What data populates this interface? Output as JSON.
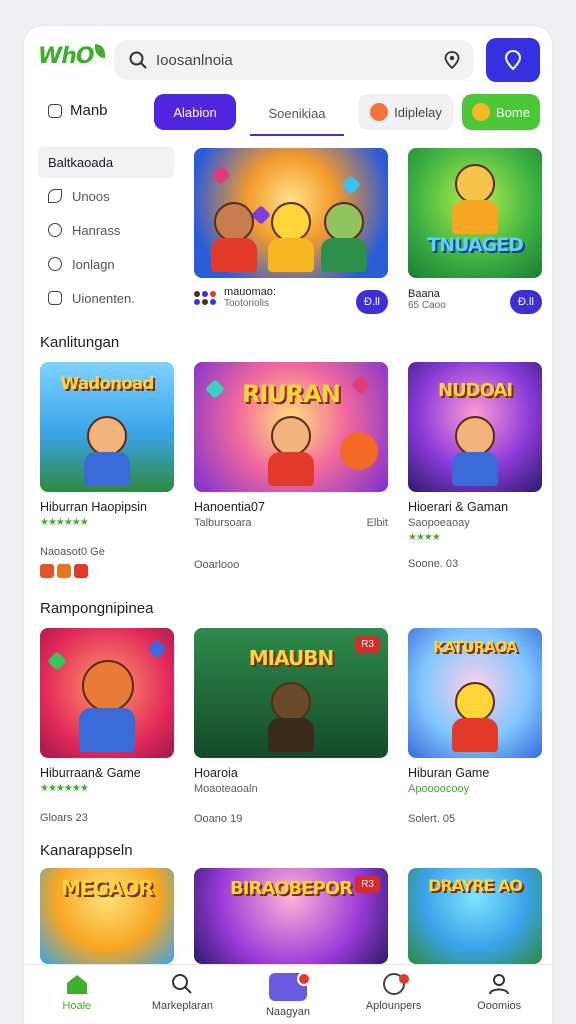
{
  "header": {
    "logo": "WhO",
    "search_value": "Ioosanlnoia",
    "search_icon": "search-icon",
    "location_icon": "location-pin-icon",
    "action_icon": "location-pin-icon",
    "accent": "#3530e0",
    "brand_green": "#3fae2a"
  },
  "topnav": {
    "menu_label": "Manb",
    "tabs": [
      {
        "label": "Alabion"
      },
      {
        "label": "Soenikiaa"
      },
      {
        "label": "Idiplelay"
      },
      {
        "label": "Bome"
      }
    ]
  },
  "sidebar": {
    "active": "Baltkaoada",
    "items": [
      {
        "label": "Unoos"
      },
      {
        "label": "Hanrass"
      },
      {
        "label": "Ionlagn"
      },
      {
        "label": "Uionenten."
      }
    ]
  },
  "featured": [
    {
      "caption": "mauomao:",
      "sub": "Tootoriolis",
      "button": "Ð.ll",
      "img_text": ""
    },
    {
      "caption": "Baana",
      "sub": "65 Caoo",
      "button": "Ð.ll",
      "img_text": "TNUAGED"
    }
  ],
  "section1": {
    "title": "Kanlitungan",
    "cards": [
      {
        "img_text": "Wadonoad",
        "title": "Hiburran Haopipsin",
        "stars": "★★★★★★",
        "meta": "Naoasot0 Ge",
        "icons": [
          "#e0542a",
          "#e6771e",
          "#e13a2b"
        ]
      },
      {
        "img_text": "RIURAN",
        "title": "Hanoentia07",
        "sub": "Talbursoara",
        "badge": "Elbit",
        "meta": "Ooarlooo"
      },
      {
        "img_text": "NUDOAI",
        "title": "Hioerari & Gaman",
        "sub": "Saopoeaoay",
        "stars": "★★★★",
        "meta": "Soone. 03"
      }
    ]
  },
  "section2": {
    "title": "Rampongnipinea",
    "cards": [
      {
        "title": "Hiburraan& Game",
        "stars": "★★★★★★",
        "meta": "Gloars 23"
      },
      {
        "img_text": "MIAUBN",
        "title": "Hoaroia",
        "sub": "Moaoteaoaln",
        "badge": "R3",
        "meta": "Ooano 19"
      },
      {
        "img_text": "KATURAOA",
        "title": "Hiburan Game",
        "sub": "Apoooocooy",
        "meta": "Solert. 05"
      }
    ]
  },
  "section3": {
    "title": "Kanarappseln",
    "cards": [
      {
        "img_text": "MEGAOR"
      },
      {
        "img_text": "BIRAOBEPOR",
        "badge": "R3"
      },
      {
        "img_text": "DRAYRE AO"
      }
    ]
  },
  "bottom_nav": [
    {
      "label": "Hoale",
      "icon": "home-icon"
    },
    {
      "label": "Markeplaran",
      "icon": "search-icon"
    },
    {
      "label": "Naagyan",
      "icon": "chat-icon"
    },
    {
      "label": "Aplounpers",
      "icon": "chat-bubble-icon"
    },
    {
      "label": "Ooomios",
      "icon": "user-icon"
    }
  ]
}
